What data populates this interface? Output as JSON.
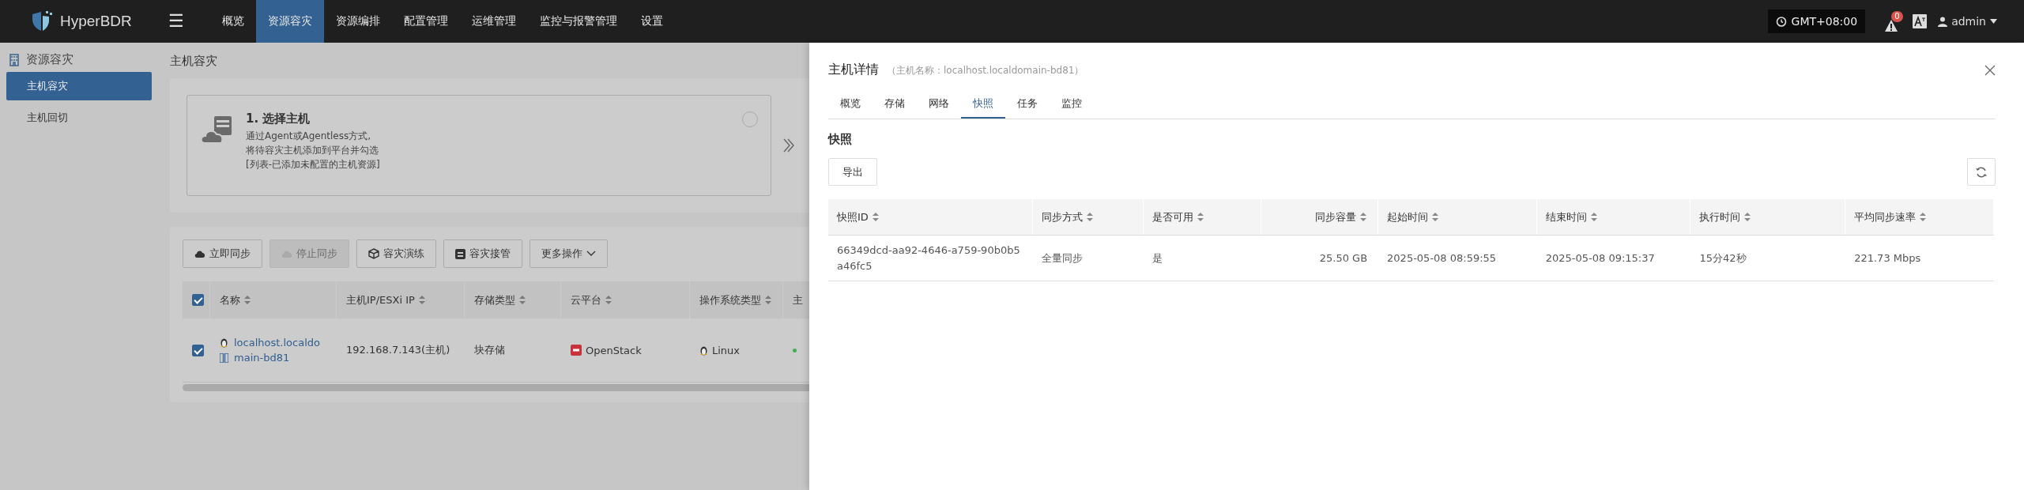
{
  "topbar": {
    "brand": "HyperBDR",
    "menu_icon": "☰",
    "nav": [
      {
        "label": "概览",
        "selected": false
      },
      {
        "label": "资源容灾",
        "selected": true
      },
      {
        "label": "资源编排",
        "selected": false
      },
      {
        "label": "配置管理",
        "selected": false
      },
      {
        "label": "运维管理",
        "selected": false
      },
      {
        "label": "监控与报警管理",
        "selected": false
      },
      {
        "label": "设置",
        "selected": false
      }
    ],
    "timezone": "GMT+08:00",
    "alert_count": "0",
    "user": "admin"
  },
  "sidebar": {
    "title": "资源容灾",
    "items": [
      {
        "label": "主机容灾",
        "selected": true
      },
      {
        "label": "主机回切",
        "selected": false
      }
    ]
  },
  "page": {
    "title": "主机容灾",
    "step": {
      "title": "1. 选择主机",
      "lines": [
        "通过Agent或Agentless方式,",
        "将待容灾主机添加到平台并勾选",
        "[列表-已添加未配置的主机资源]"
      ],
      "checked": false
    },
    "actions": [
      {
        "label": "立即同步",
        "disabled": false,
        "kind": "sync"
      },
      {
        "label": "停止同步",
        "disabled": true,
        "kind": "sync"
      },
      {
        "label": "容灾演练",
        "disabled": false,
        "kind": "drill"
      },
      {
        "label": "容灾接管",
        "disabled": false,
        "kind": "takeover"
      },
      {
        "label": "更多操作",
        "disabled": false,
        "kind": "more"
      }
    ],
    "table": {
      "all_checked": true,
      "columns": [
        "名称",
        "主机IP/ESXi IP",
        "存储类型",
        "云平台",
        "操作系统类型",
        "主"
      ],
      "rows": [
        {
          "checked": true,
          "name_lines": [
            "localhost.localdo",
            "main-bd81"
          ],
          "ip": "192.168.7.143",
          "ip_note": "(主机)",
          "storage": "块存储",
          "cloud": "OpenStack",
          "os": "Linux"
        }
      ]
    }
  },
  "drawer": {
    "title": "主机详情",
    "subtitle": "（主机名称：localhost.localdomain-bd81）",
    "tabs": [
      {
        "label": "概览",
        "selected": false
      },
      {
        "label": "存储",
        "selected": false
      },
      {
        "label": "网络",
        "selected": false
      },
      {
        "label": "快照",
        "selected": true
      },
      {
        "label": "任务",
        "selected": false
      },
      {
        "label": "监控",
        "selected": false
      }
    ],
    "section": "快照",
    "export": "导出",
    "table": {
      "columns": [
        {
          "label": "快照ID",
          "right_aligned": false
        },
        {
          "label": "同步方式",
          "right_aligned": false
        },
        {
          "label": "是否可用",
          "right_aligned": false
        },
        {
          "label": "同步容量",
          "right_aligned": true
        },
        {
          "label": "起始时间",
          "right_aligned": false
        },
        {
          "label": "结束时间",
          "right_aligned": false
        },
        {
          "label": "执行时间",
          "right_aligned": false
        },
        {
          "label": "平均同步速率",
          "right_aligned": false
        }
      ],
      "rows": [
        [
          "66349dcd-aa92-4646-a759-90b0b5a46fc5",
          "全量同步",
          "是",
          "25.50 GB",
          "2025-05-08 08:59:55",
          "2025-05-08 09:15:37",
          "15分42秒",
          "221.73 Mbps"
        ]
      ]
    }
  }
}
